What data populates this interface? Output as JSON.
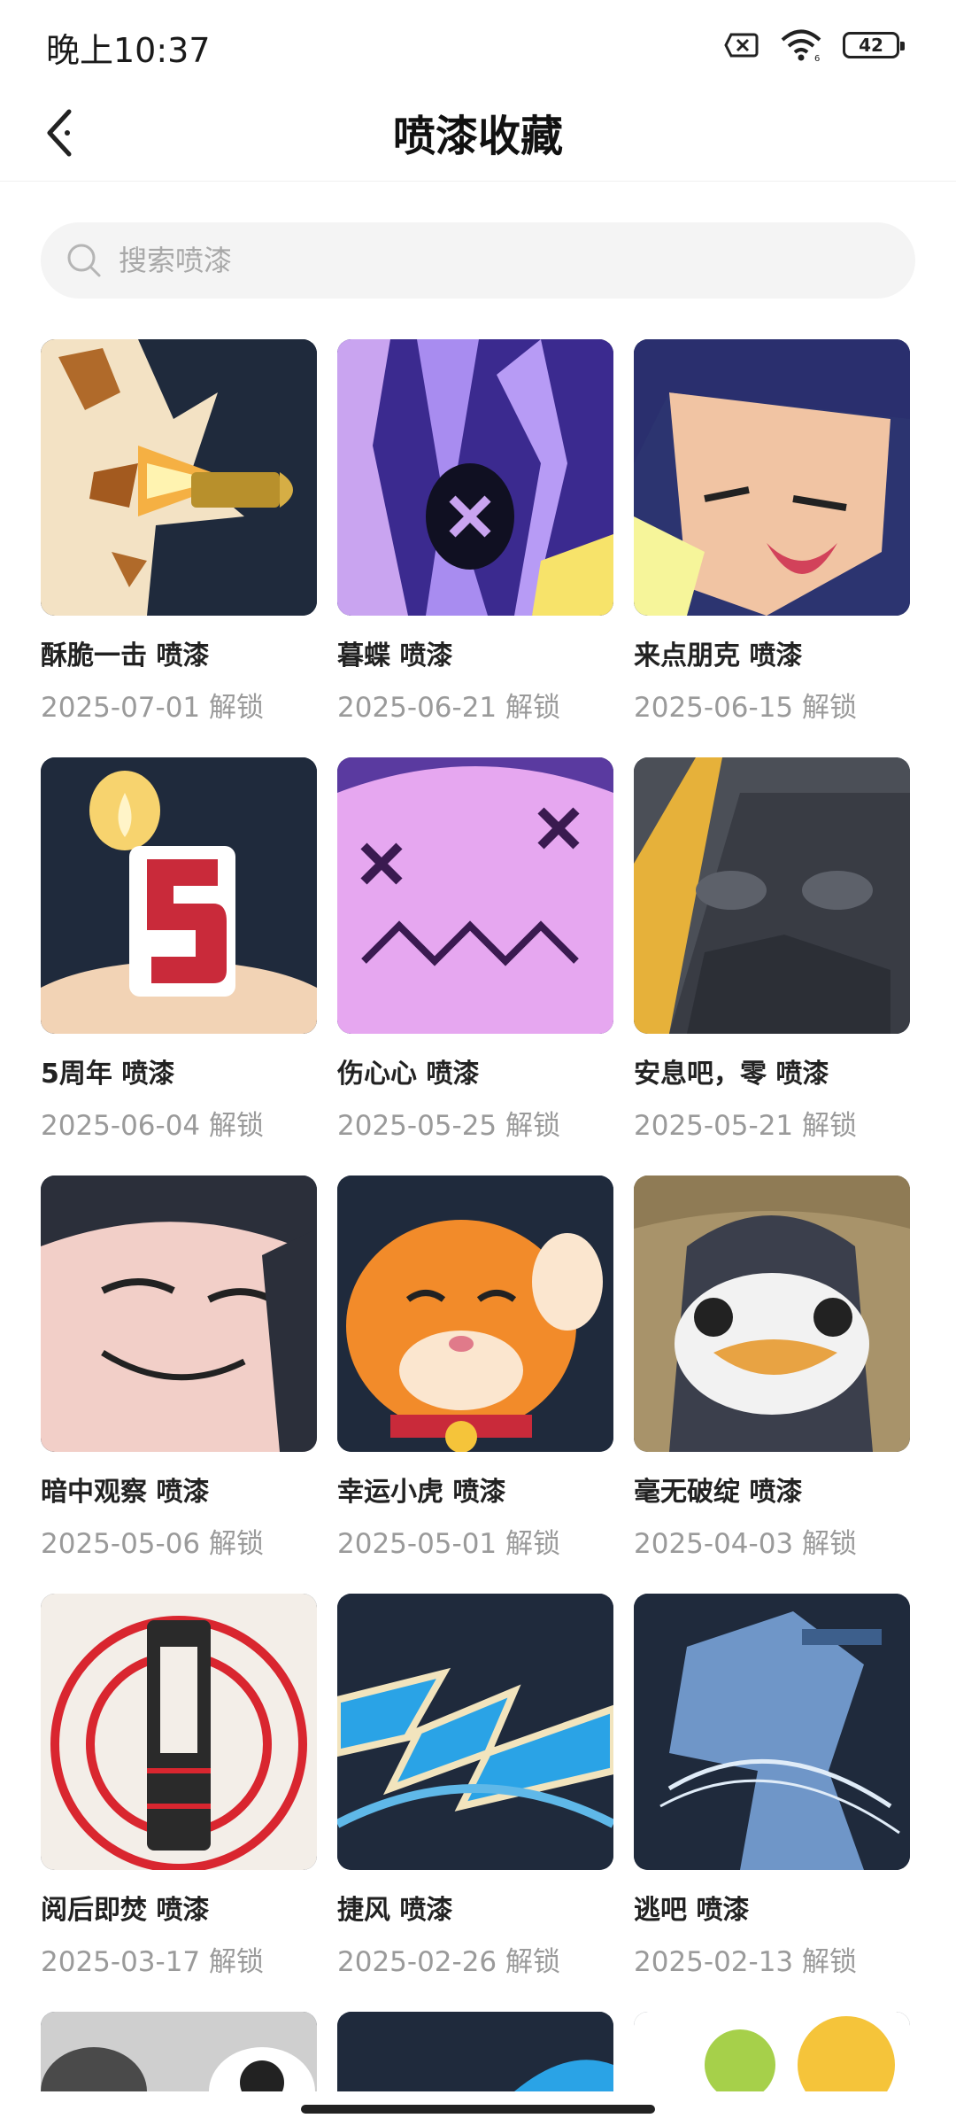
{
  "status": {
    "time": "晚上10:37",
    "battery": "42"
  },
  "header": {
    "title": "喷漆收藏"
  },
  "search": {
    "placeholder": "搜索喷漆"
  },
  "sprays": [
    {
      "name": "酥脆一击 喷漆",
      "date": "2025-07-01 解锁",
      "icon": "bullet-explosion"
    },
    {
      "name": "暮蝶 喷漆",
      "date": "2025-06-21 解锁",
      "icon": "purple-abstract-butterfly"
    },
    {
      "name": "来点朋克 喷漆",
      "date": "2025-06-15 解锁",
      "icon": "punk-character"
    },
    {
      "name": "5周年 喷漆",
      "date": "2025-06-04 解锁",
      "icon": "birthday-candle-5"
    },
    {
      "name": "伤心心 喷漆",
      "date": "2025-05-25 解锁",
      "icon": "sad-heart"
    },
    {
      "name": "安息吧，零 喷漆",
      "date": "2025-05-21 解锁",
      "icon": "hooded-figure"
    },
    {
      "name": "暗中观察 喷漆",
      "date": "2025-05-06 解锁",
      "icon": "peeking-face"
    },
    {
      "name": "幸运小虎 喷漆",
      "date": "2025-05-01 解锁",
      "icon": "lucky-tiger"
    },
    {
      "name": "毫无破绽 喷漆",
      "date": "2025-04-03 解锁",
      "icon": "penguin-disguise"
    },
    {
      "name": "阅后即焚 喷漆",
      "date": "2025-03-17 解锁",
      "icon": "red-target-tower"
    },
    {
      "name": "捷风 喷漆",
      "date": "2025-02-26 解锁",
      "icon": "blue-wind-logo"
    },
    {
      "name": "逃吧 喷漆",
      "date": "2025-02-13 解锁",
      "icon": "blue-ninja"
    }
  ],
  "colors": {
    "accent_dark": "#1f2a3c",
    "muted_text": "#9a9a9a"
  }
}
